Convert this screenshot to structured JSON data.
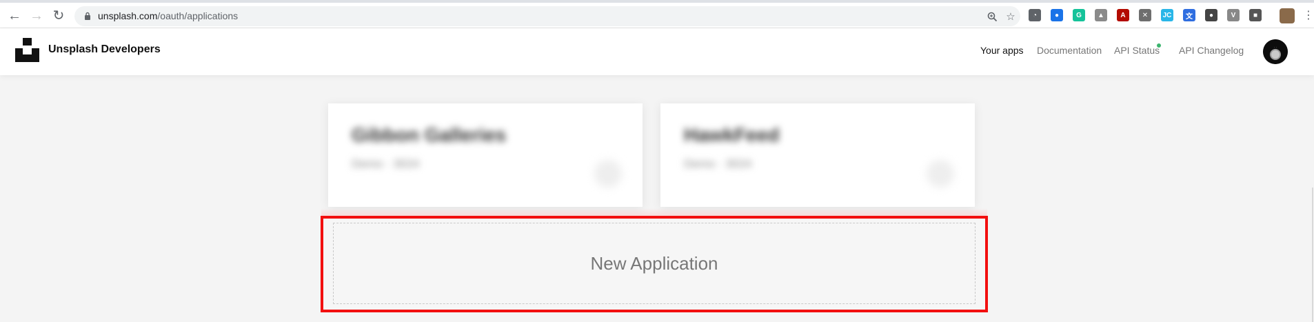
{
  "browser": {
    "url_host": "unsplash.com",
    "url_path": "/oauth/applications",
    "back_icon": "arrow-left-icon",
    "forward_icon": "arrow-right-icon",
    "reload_icon": "reload-icon",
    "extensions": [
      {
        "name": "speed-dial-icon",
        "color": "#5f6368",
        "glyph": "◔"
      },
      {
        "name": "globe-extension-icon",
        "color": "#1a73e8",
        "glyph": "●"
      },
      {
        "name": "grammarly-icon",
        "color": "#15c39a",
        "glyph": "G"
      },
      {
        "name": "drive-icon",
        "color": "#8a8a8a",
        "glyph": "▲"
      },
      {
        "name": "pdf-icon",
        "color": "#b30b00",
        "glyph": "A"
      },
      {
        "name": "x-extension-icon",
        "color": "#6e6e6e",
        "glyph": "✕"
      },
      {
        "name": "jc-extension-icon",
        "color": "#29b6e8",
        "glyph": "JC"
      },
      {
        "name": "translate-icon",
        "color": "#2f6ee0",
        "glyph": "文"
      },
      {
        "name": "sphere-extension-icon",
        "color": "#444444",
        "glyph": "●"
      },
      {
        "name": "v-extension-icon",
        "color": "#888888",
        "glyph": "V"
      },
      {
        "name": "unsplash-extension-icon",
        "color": "#555555",
        "glyph": "■"
      }
    ]
  },
  "header": {
    "brand": "Unsplash Developers",
    "nav": [
      {
        "label": "Your apps",
        "active": true
      },
      {
        "label": "Documentation",
        "active": false
      },
      {
        "label": "API Status",
        "active": false
      },
      {
        "label": "API Changelog",
        "active": false
      }
    ],
    "status_color": "#3cb46e"
  },
  "apps": [
    {
      "name": "Gibbon Galleries",
      "meta": "Demo · 3024"
    },
    {
      "name": "HawkFeed",
      "meta": "Demo · 3024"
    }
  ],
  "new_application": {
    "label": "New Application"
  },
  "colors": {
    "highlight": "#f20f0f",
    "background": "#f4f4f4"
  }
}
